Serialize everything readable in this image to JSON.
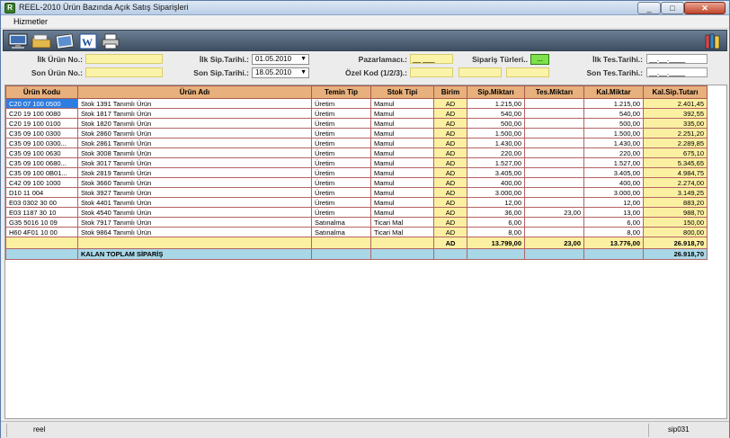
{
  "window": {
    "title": "REEL-2010 Ürün Bazında Açık Satış Siparişleri",
    "app_icon": "app-logo-icon",
    "min": "_",
    "max": "□",
    "close": "✕"
  },
  "menu": {
    "hizmetler": "Hizmetler"
  },
  "toolbar": {
    "icons": [
      "monitor-icon",
      "folder-icon",
      "image-icon",
      "word-icon",
      "printer-icon",
      "books-icon"
    ]
  },
  "filters": {
    "ilk_urun_label": "İlk Ürün No.:",
    "son_urun_label": "Son Ürün No.:",
    "ilk_sip_label": "İlk Sip.Tarihi.:",
    "ilk_sip_value": "01.05.2010",
    "son_sip_label": "Son Sip.Tarihi.:",
    "son_sip_value": "18.05.2010",
    "pazarlamaci_label": "Pazarlamacı.:",
    "pazarlamaci_value": "__ ___",
    "ozel_kod_label": "Özel Kod (1/2/3).:",
    "siparis_turleri_label": "Sipariş Türleri..",
    "siparis_turleri_value": "...",
    "ilk_tes_label": "İlk Tes.Tarihi.:",
    "ilk_tes_value": "__.__.____",
    "son_tes_label": "Son Tes.Tarihi.:",
    "son_tes_value": "__.__.____"
  },
  "table": {
    "headers": [
      "Ürün Kodu",
      "Ürün Adı",
      "Temin Tip",
      "Stok Tipi",
      "Birim",
      "Sip.Miktarı",
      "Tes.Miktarı",
      "Kal.Miktar",
      "Kal.Sip.Tutarı"
    ],
    "rows": [
      [
        "C20 07 100 0500",
        "Stok 1391 Tanımlı Ürün",
        "Üretim",
        "Mamul",
        "AD",
        "1.215,00",
        "",
        "1.215,00",
        "2.401,45"
      ],
      [
        "C20 19 100 0080",
        "Stok 1817 Tanımlı Ürün",
        "Üretim",
        "Mamul",
        "AD",
        "540,00",
        "",
        "540,00",
        "392,55"
      ],
      [
        "C20 19 100 0100",
        "Stok 1820 Tanımlı Ürün",
        "Üretim",
        "Mamul",
        "AD",
        "500,00",
        "",
        "500,00",
        "335,00"
      ],
      [
        "C35 09 100 0300",
        "Stok 2860 Tanımlı Ürün",
        "Üretim",
        "Mamul",
        "AD",
        "1.500,00",
        "",
        "1.500,00",
        "2.251,20"
      ],
      [
        "C35 09 100 0300...",
        "Stok 2861 Tanımlı Ürün",
        "Üretim",
        "Mamul",
        "AD",
        "1.430,00",
        "",
        "1.430,00",
        "2.289,85"
      ],
      [
        "C35 09 100 0630",
        "Stok 3008 Tanımlı Ürün",
        "Üretim",
        "Mamul",
        "AD",
        "220,00",
        "",
        "220,00",
        "675,10"
      ],
      [
        "C35 09 100 0680...",
        "Stok 3017 Tanımlı Ürün",
        "Üretim",
        "Mamul",
        "AD",
        "1.527,00",
        "",
        "1.527,00",
        "5.345,65"
      ],
      [
        "C35 09 100 0B01...",
        "Stok 2819 Tanımlı Ürün",
        "Üretim",
        "Mamul",
        "AD",
        "3.405,00",
        "",
        "3.405,00",
        "4.984,75"
      ],
      [
        "C42 09 100 1000",
        "Stok 3660 Tanımlı Ürün",
        "Üretim",
        "Mamul",
        "AD",
        "400,00",
        "",
        "400,00",
        "2.274,00"
      ],
      [
        "D10 11 004",
        "Stok 3927 Tanımlı Ürün",
        "Üretim",
        "Mamul",
        "AD",
        "3.000,00",
        "",
        "3.000,00",
        "3.149,25"
      ],
      [
        "E03 0302 30 00",
        "Stok 4401 Tanımlı Ürün",
        "Üretim",
        "Mamul",
        "AD",
        "12,00",
        "",
        "12,00",
        "883,20"
      ],
      [
        "E03 1187 30 10",
        "Stok 4540 Tanımlı Ürün",
        "Üretim",
        "Mamul",
        "AD",
        "36,00",
        "23,00",
        "13,00",
        "988,70"
      ],
      [
        "G35 5016 10 09",
        "Stok 7917 Tanımlı Ürün",
        "Satınalma",
        "Ticari Mal",
        "AD",
        "6,00",
        "",
        "6,00",
        "150,00"
      ],
      [
        "H60 4F01 10 00",
        "Stok 9864 Tanımlı Ürün",
        "Satınalma",
        "Ticari Mal",
        "AD",
        "8,00",
        "",
        "8,00",
        "800,00"
      ]
    ],
    "total": {
      "birim": "AD",
      "sip": "13.799,00",
      "tes": "23,00",
      "kal": "13.776,00",
      "tutar": "26.918,70"
    },
    "kalan": {
      "label": "KALAN TOPLAM SİPARİŞ",
      "tutar": "26.918,70"
    }
  },
  "status": {
    "left": "reel",
    "right": "sip031"
  }
}
